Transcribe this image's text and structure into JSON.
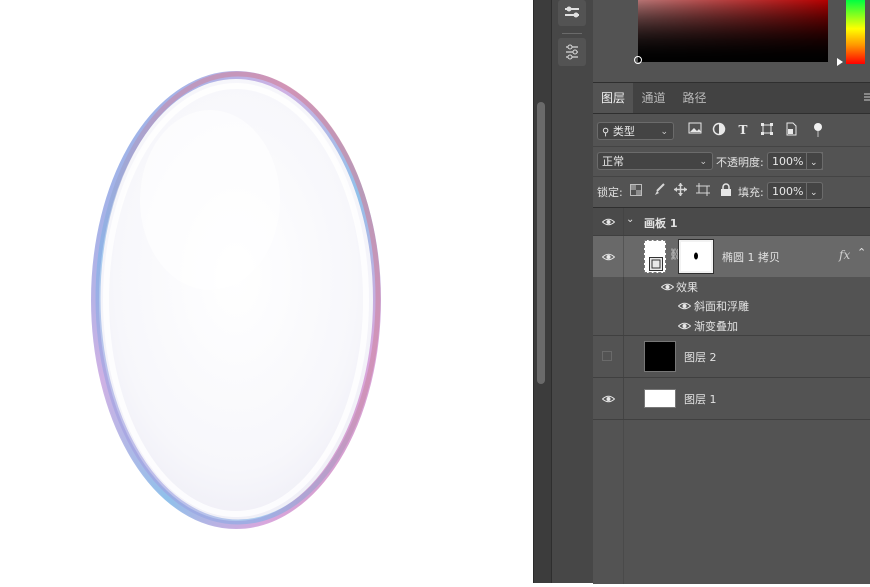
{
  "panel_tabs": [
    "图层",
    "通道",
    "路径"
  ],
  "filter": {
    "kind_label": "类型"
  },
  "blend": {
    "mode": "正常",
    "opacity_label": "不透明度:",
    "opacity_value": "100%"
  },
  "lock": {
    "label": "锁定:",
    "fill_label": "填充:",
    "fill_value": "100%"
  },
  "group": {
    "name": "画板 1"
  },
  "layers": [
    {
      "name": "椭圆 1 拷贝",
      "fx": "fx",
      "effects_label": "效果",
      "effects": [
        "斜面和浮雕",
        "渐变叠加"
      ]
    },
    {
      "name": "图层 2"
    },
    {
      "name": "图层 1"
    }
  ],
  "colors": {
    "panel_bg": "#535353",
    "tab_bar": "#424242",
    "selected_row": "#696969",
    "canvas": "#ffffff"
  }
}
